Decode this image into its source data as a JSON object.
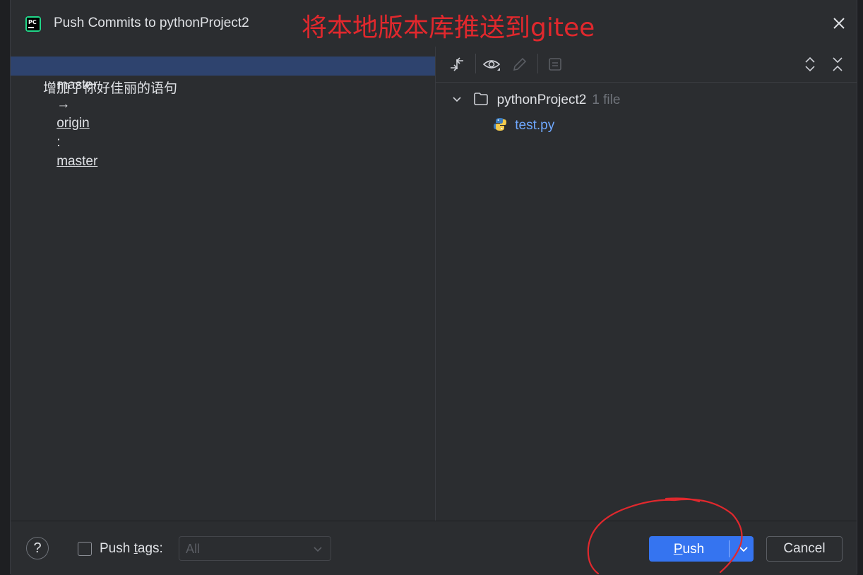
{
  "window": {
    "title": "Push Commits to pythonProject2",
    "annotation": "将本地版本库推送到gitee"
  },
  "left_pane": {
    "commit_row": {
      "local_branch": "master",
      "arrow": "→",
      "remote": "origin",
      "separator": ":",
      "remote_branch": "master"
    },
    "commit_message": "增加了你好佳丽的语句"
  },
  "right_pane": {
    "toolbar_icons": [
      "compare-icon",
      "eye-icon",
      "edit-icon",
      "document-icon",
      "expand-all-icon",
      "collapse-all-icon"
    ],
    "tree": {
      "folder": "pythonProject2",
      "folder_count": "1 file",
      "file": "test.py"
    }
  },
  "footer": {
    "help_label": "?",
    "push_tags_label_pre": "Push ",
    "push_tags_label_mnemonic": "t",
    "push_tags_label_post": "ags:",
    "push_tags_checked": false,
    "tags_select_value": "All",
    "push_label_mnemonic": "P",
    "push_label_rest": "ush",
    "cancel_label": "Cancel"
  },
  "colors": {
    "accent": "#3574f0",
    "selection": "#2e436e",
    "annotation_red": "#e0282d",
    "link": "#6fa8ff"
  }
}
